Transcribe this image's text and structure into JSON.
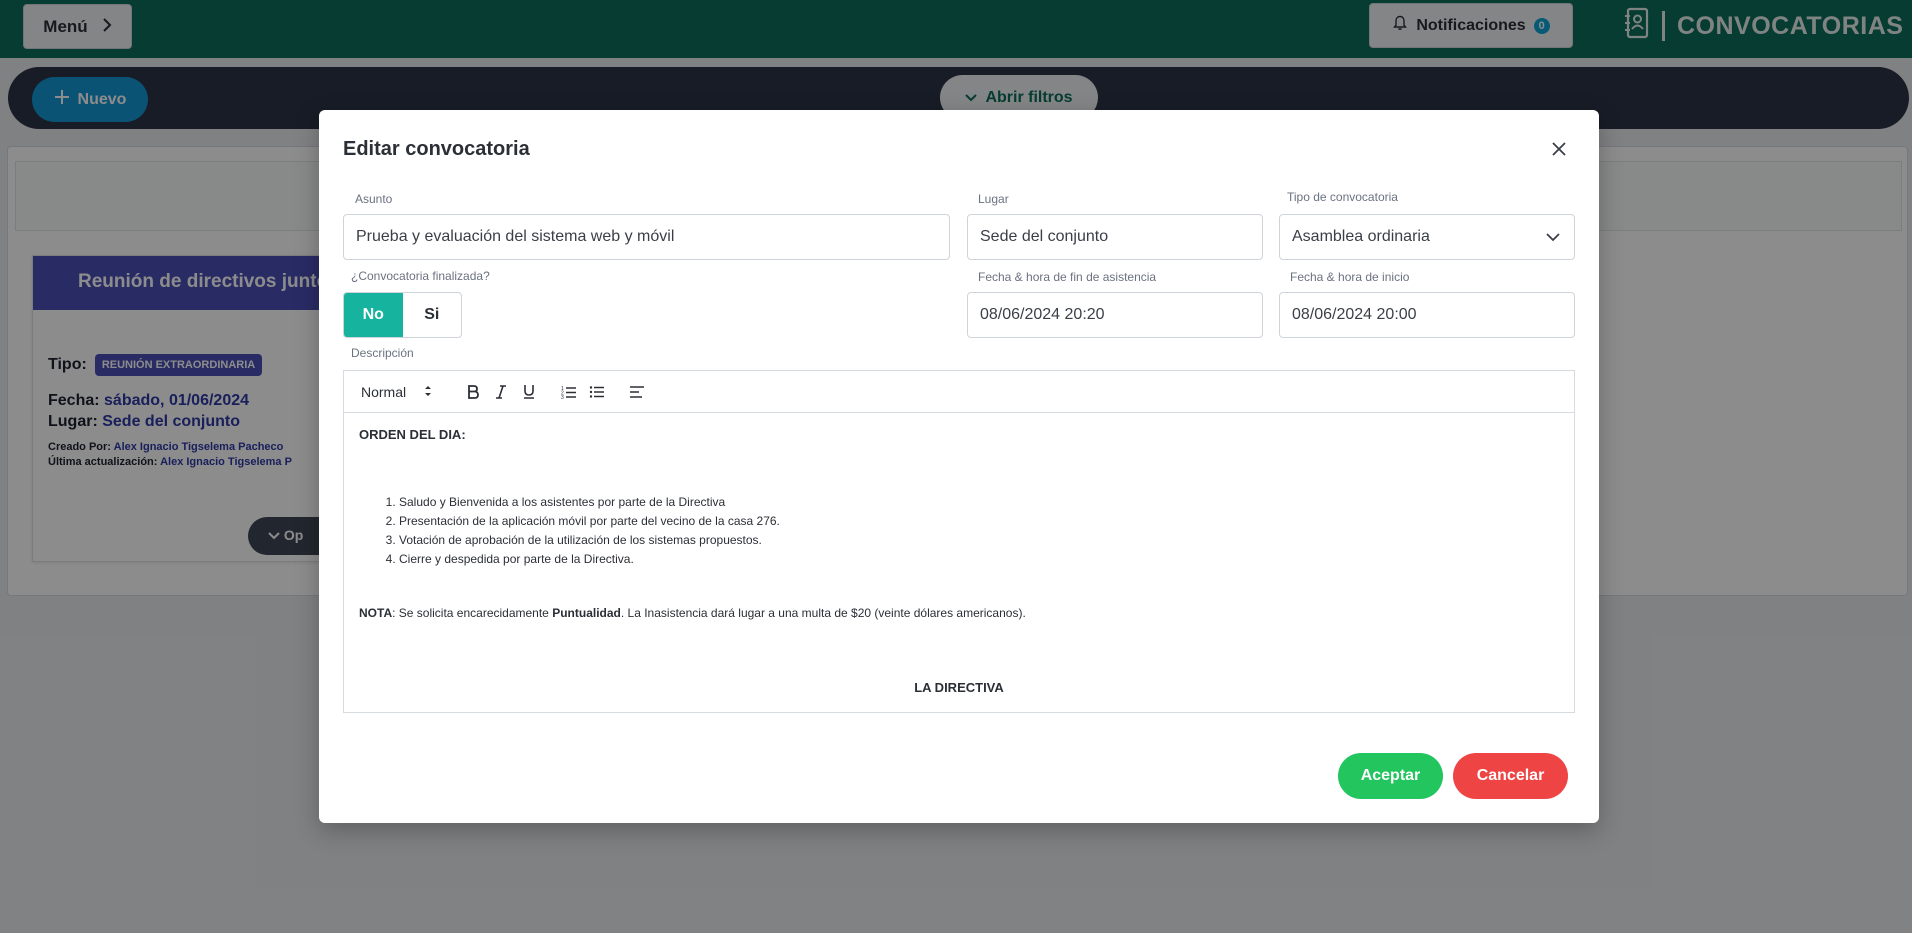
{
  "topbar": {
    "menu_label": "Menú",
    "notifications_label": "Notificaciones",
    "notifications_count": "0",
    "app_title": "CONVOCATORIAS"
  },
  "actionbar": {
    "new_label": "Nuevo",
    "filters_label": "Abrir filtros"
  },
  "card": {
    "title": "Reunión de directivos junto",
    "tipo_label": "Tipo:",
    "tipo_value": "REUNIÓN EXTRAORDINARIA",
    "fecha_label": "Fecha:",
    "fecha_value": "sábado, 01/06/2024",
    "lugar_label": "Lugar:",
    "lugar_value": "Sede del conjunto",
    "creado_label": "Creado Por:",
    "creado_value": "Alex Ignacio Tigselema Pacheco",
    "actualizacion_label": "Última actualización:",
    "actualizacion_value": "Alex Ignacio Tigselema P",
    "options_label": "Op"
  },
  "modal": {
    "title": "Editar convocatoria",
    "asunto_label": "Asunto",
    "asunto_value": "Prueba y evaluación del sistema web y móvil",
    "lugar_label": "Lugar",
    "lugar_value": "Sede del conjunto",
    "tipo_label": "Tipo de convocatoria",
    "tipo_value": "Asamblea ordinaria",
    "finalizada_label": "¿Convocatoria finalizada?",
    "toggle_no": "No",
    "toggle_si": "Si",
    "fin_label": "Fecha & hora de fin de asistencia",
    "fin_value": "08/06/2024 20:20",
    "inicio_label": "Fecha & hora de inicio",
    "inicio_value": "08/06/2024 20:00",
    "descripcion_label": "Descripción",
    "accept_label": "Aceptar",
    "cancel_label": "Cancelar"
  },
  "editor": {
    "format_select": "Normal",
    "heading": "ORDEN DEL DIA:",
    "items": [
      "Saludo y Bienvenida a los asistentes por parte de la Directiva",
      "Presentación de la aplicación móvil por parte del vecino de la casa 276.",
      "Votación de aprobación de la utilización de los sistemas propuestos.",
      "Cierre y despedida por parte de la Directiva."
    ],
    "note_bold1": "NOTA",
    "note_text1": ": Se solicita encarecidamente ",
    "note_bold2": "Puntualidad",
    "note_text2": ". La Inasistencia dará lugar a una multa de $20 (veinte dólares americanos).",
    "signature": "LA DIRECTIVA"
  },
  "colors": {
    "topbar": "#0c6e5a",
    "primary": "#1497d6",
    "toggle_on": "#16b39e",
    "accept": "#22c55e",
    "cancel": "#ef4444",
    "card_header": "#4b4fb7"
  }
}
